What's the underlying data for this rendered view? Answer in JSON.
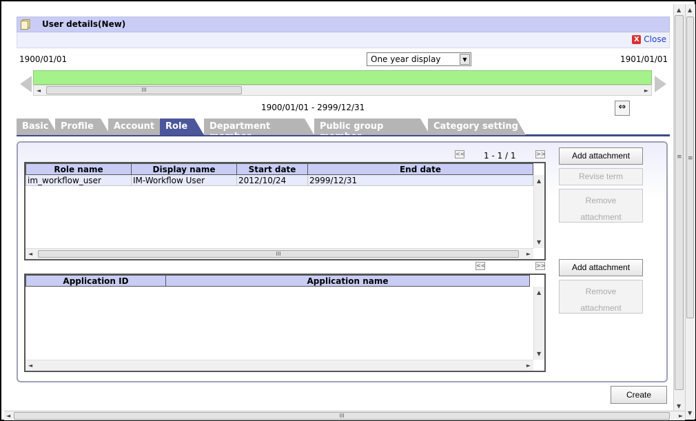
{
  "header": {
    "title": "User details(New)",
    "close_label": "Close",
    "close_glyph": "X"
  },
  "timeline": {
    "start_date": "1900/01/01",
    "end_date": "1901/01/01",
    "period_option": "One year display",
    "range_text": "1900/01/01 - 2999/12/31",
    "scroll_grip": "III"
  },
  "tabs": [
    {
      "label": "Basic"
    },
    {
      "label": "Profile"
    },
    {
      "label": "Account"
    },
    {
      "label": "Role"
    },
    {
      "label": "Department member"
    },
    {
      "label": "Public group member"
    },
    {
      "label": "Category setting"
    }
  ],
  "active_tab": "Role",
  "roles": {
    "pager_prev": "<<",
    "pager_next": ">>",
    "pager_text": "1 - 1 / 1",
    "columns": [
      "Role name",
      "Display name",
      "Start date",
      "End date"
    ],
    "rows": [
      {
        "role_name": "im_workflow_user",
        "display_name": "IM-Workflow User",
        "start_date": "2012/10/24",
        "end_date": "2999/12/31"
      }
    ],
    "buttons": {
      "add": "Add attachment",
      "revise": "Revise term",
      "remove_line1": "Remove",
      "remove_line2": "attachment"
    }
  },
  "applications": {
    "pager_prev": "<<",
    "pager_next": ">>",
    "columns": [
      "Application ID",
      "Application name"
    ],
    "buttons": {
      "add": "Add attachment",
      "remove_line1": "Remove",
      "remove_line2": "attachment"
    }
  },
  "footer": {
    "create_label": "Create"
  },
  "glyphs": {
    "left": "◄",
    "right": "►",
    "up": "▲",
    "down": "▼",
    "dropdown": "▼",
    "fit": "⇔",
    "grip_v": "≡"
  },
  "icons": {
    "header": "document-icon",
    "close": "close-icon",
    "fit": "fit-width-icon"
  },
  "colors": {
    "header_bg": "#c9cdf5",
    "active_tab": "#4b579a",
    "timeline_bar": "#a6f28a",
    "close_link": "#1a3ec9"
  }
}
